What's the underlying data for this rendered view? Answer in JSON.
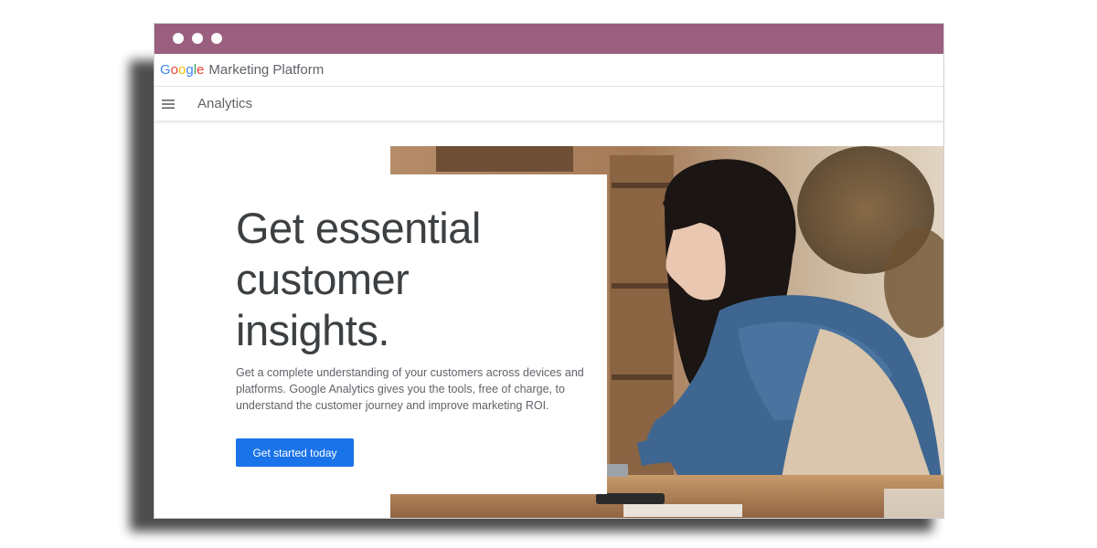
{
  "brand": {
    "logo_letters": [
      {
        "char": "G",
        "color": "#4285F4"
      },
      {
        "char": "o",
        "color": "#EA4335"
      },
      {
        "char": "o",
        "color": "#FBBC05"
      },
      {
        "char": "g",
        "color": "#4285F4"
      },
      {
        "char": "l",
        "color": "#34A853"
      },
      {
        "char": "e",
        "color": "#EA4335"
      }
    ],
    "subtitle": "Marketing Platform"
  },
  "nav": {
    "menu_icon": "hamburger-menu-icon",
    "title": "Analytics"
  },
  "hero": {
    "headline_lines": [
      "Get essential",
      "customer",
      "insights."
    ],
    "description": "Get a complete understanding of your customers across devices and platforms. Google Analytics gives you the tools, free of charge, to understand the customer journey and improve marketing ROI.",
    "cta_label": "Get started today",
    "image_alt": "woman-working-on-laptop-photo"
  },
  "colors": {
    "titlebar": "#9a5f7f",
    "cta": "#1a73e8",
    "headline": "#3c4043",
    "body_text": "#5f6368"
  }
}
